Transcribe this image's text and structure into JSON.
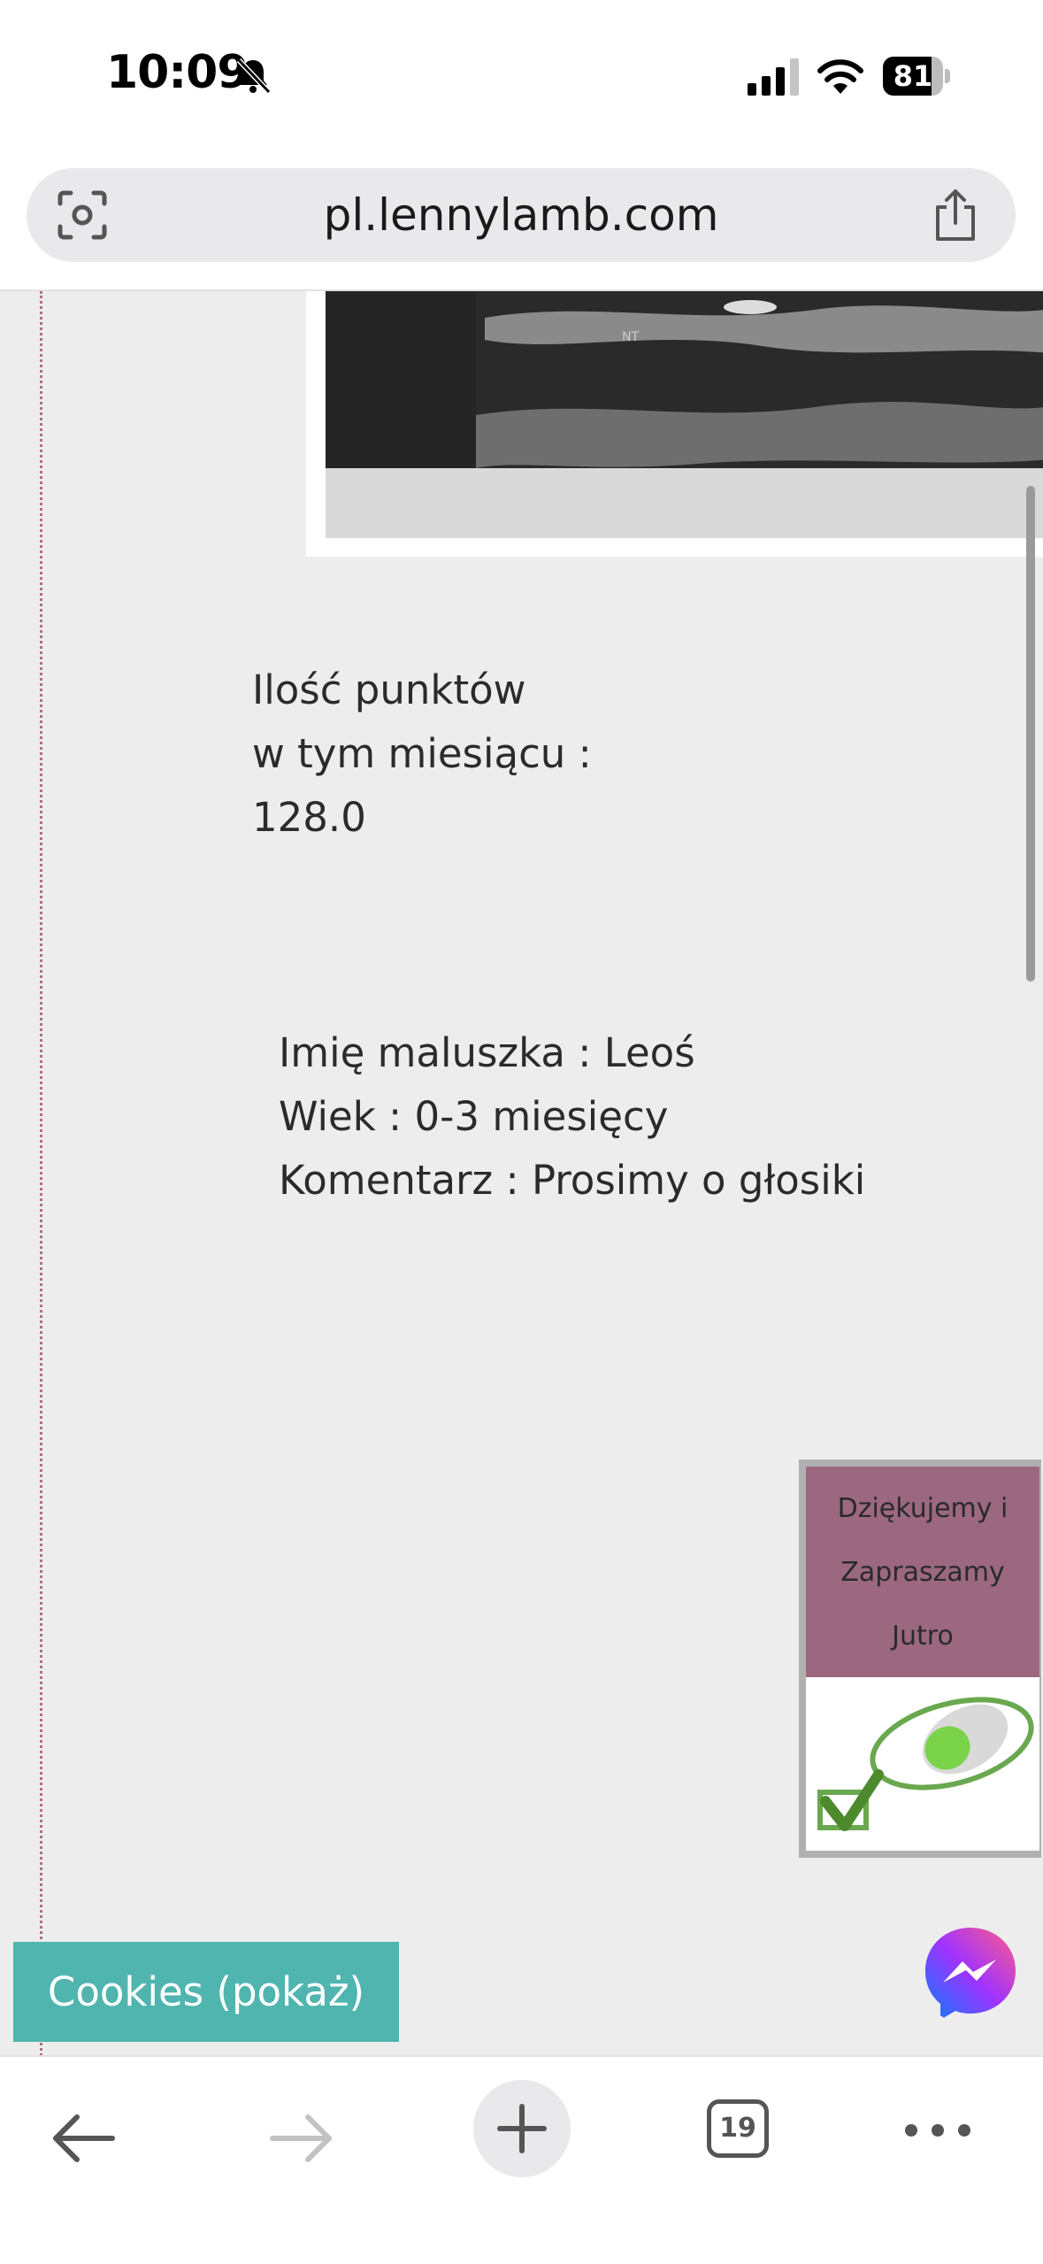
{
  "status_bar": {
    "time": "10:09",
    "battery": "81",
    "battery_level_percent": 81
  },
  "browser": {
    "url": "pl.lennylamb.com",
    "tab_count": "19"
  },
  "content": {
    "points_line1": "Ilość punktów",
    "points_line2": "w tym miesiącu :",
    "points_value": "128.0",
    "baby_name": "Imię maluszka : Leoś",
    "baby_age": "Wiek : 0-3 miesięcy",
    "baby_comment": "Komentarz : Prosimy o głosiki"
  },
  "thanks_box": {
    "line1": "Dziękujemy i",
    "line2": "Zapraszamy",
    "line3": "Jutro"
  },
  "cookies_label": "Cookies (pokaż)",
  "icons": [
    "bell-off-icon",
    "signal-icon",
    "wifi-icon",
    "lens-icon",
    "share-icon",
    "back-icon",
    "forward-icon",
    "plus-icon",
    "more-icon",
    "messenger-icon",
    "mouse-checkmark-icon"
  ],
  "colors": {
    "accent_teal": "#4fb5ae",
    "mauve": "#9b6880",
    "page_bg": "#ededed"
  }
}
